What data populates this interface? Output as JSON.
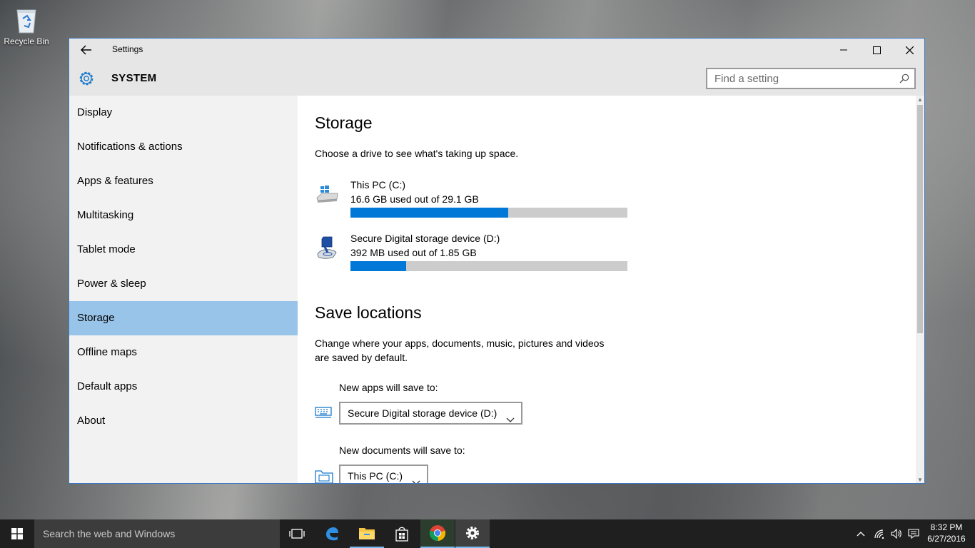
{
  "desktop": {
    "recycle_bin_label": "Recycle Bin"
  },
  "window": {
    "title": "Settings"
  },
  "header": {
    "section_title": "SYSTEM",
    "search_placeholder": "Find a setting"
  },
  "sidebar": {
    "items": [
      {
        "label": "Display"
      },
      {
        "label": "Notifications & actions"
      },
      {
        "label": "Apps & features"
      },
      {
        "label": "Multitasking"
      },
      {
        "label": "Tablet mode"
      },
      {
        "label": "Power & sleep"
      },
      {
        "label": "Storage",
        "selected": true
      },
      {
        "label": "Offline maps"
      },
      {
        "label": "Default apps"
      },
      {
        "label": "About"
      }
    ]
  },
  "storage": {
    "heading": "Storage",
    "description": "Choose a drive to see what's taking up space.",
    "drives": [
      {
        "name": "This PC (C:)",
        "usage": "16.6 GB used out of 29.1 GB",
        "used_fraction": 0.57,
        "icon": "hard-drive-icon"
      },
      {
        "name": "Secure Digital storage device (D:)",
        "usage": "392 MB used out of 1.85 GB",
        "used_fraction": 0.2,
        "icon": "sd-card-icon"
      }
    ]
  },
  "save_locations": {
    "heading": "Save locations",
    "description_line1": "Change where your apps, documents, music, pictures and videos",
    "description_line2": "are saved by default.",
    "new_apps": {
      "label": "New apps will save to:",
      "selected": "Secure Digital storage device (D:)"
    },
    "new_documents": {
      "label": "New documents will save to:",
      "selected": "This PC (C:)"
    }
  },
  "taskbar": {
    "search_placeholder": "Search the web and Windows",
    "apps": [
      "task-view-icon",
      "edge-icon",
      "file-explorer-icon",
      "store-icon",
      "chrome-icon",
      "settings-icon"
    ],
    "time": "8:32 PM",
    "date": "6/27/2016"
  },
  "colors": {
    "accent": "#0078d7",
    "selected_nav": "#99c4ea",
    "window_border": "#3b78c4"
  }
}
